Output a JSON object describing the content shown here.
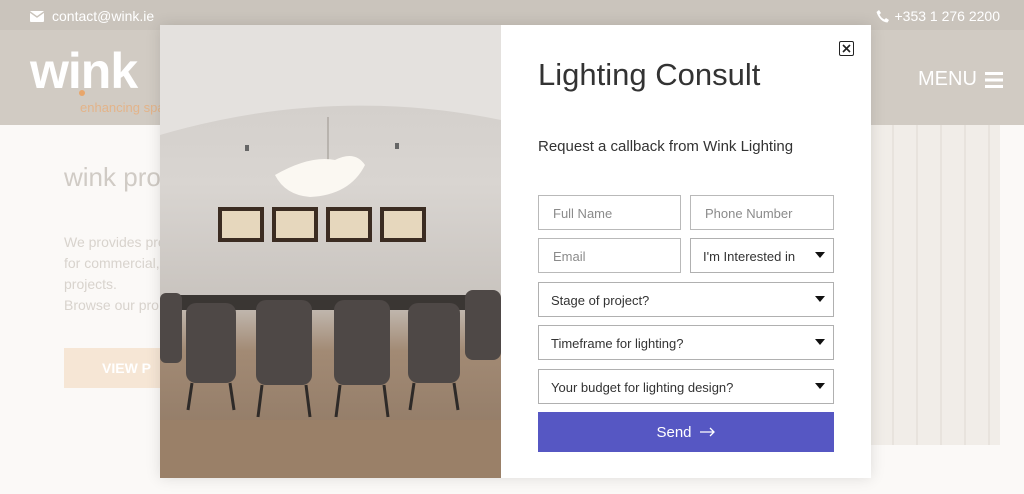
{
  "topbar": {
    "email": "contact@wink.ie",
    "phone": "+353 1 276 2200"
  },
  "header": {
    "logo": "wink",
    "tagline": "enhancing spa",
    "menu_label": "MENU"
  },
  "background": {
    "section_title": "wink pro",
    "paragraph_lines": [
      "We provides pre",
      "for commercial,",
      "projects.",
      "Browse our pro"
    ],
    "button_label": "VIEW P"
  },
  "modal": {
    "title": "Lighting Consult",
    "subtitle": "Request a callback from Wink Lighting",
    "fields": {
      "full_name_placeholder": "Full Name",
      "phone_placeholder": "Phone Number",
      "email_placeholder": "Email"
    },
    "selects": {
      "interest": "I'm Interested in",
      "stage": "Stage of project?",
      "timeframe": "Timeframe for lighting?",
      "budget": "Your budget for lighting design?"
    },
    "send_label": "Send",
    "icons": {
      "close": "close-icon",
      "send_arrow": "arrow-right-icon",
      "mail": "mail-icon",
      "phone": "phone-icon",
      "menu": "hamburger-icon"
    }
  }
}
